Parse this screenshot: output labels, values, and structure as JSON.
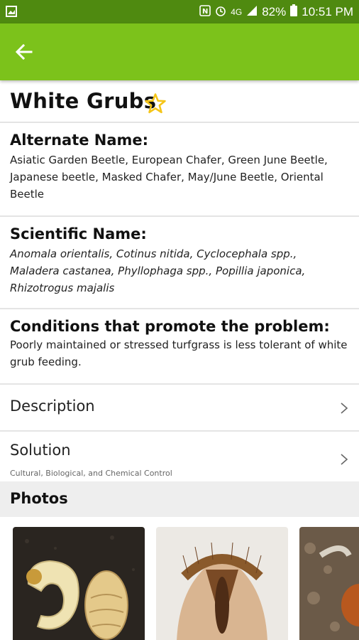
{
  "status_bar": {
    "battery": "82%",
    "network": "4G",
    "time": "10:51 PM",
    "icons": [
      "image-icon",
      "nfc-icon",
      "alarm-icon",
      "signal-icon",
      "battery-icon"
    ]
  },
  "colors": {
    "status_bar": "#4f8a10",
    "app_bar": "#7cc21b",
    "star": "#f5c518",
    "divider": "#e4e4e4",
    "photos_header_bg": "#eeeeee"
  },
  "page": {
    "title": "White Grubs"
  },
  "alternate_name": {
    "label": "Alternate Name:",
    "value": "Asiatic Garden Beetle, European Chafer, Green June Beetle, Japanese beetle, Masked Chafer, May/June Beetle, Oriental Beetle"
  },
  "scientific_name": {
    "label": "Scientific Name:",
    "value": "Anomala orientalis, Cotinus nitida, Cyclocephala spp., Maladera castanea, Phyllophaga spp., Popillia japonica, Rhizotrogus majalis"
  },
  "conditions": {
    "label": "Conditions that promote the problem:",
    "value": "Poorly maintained or stressed turfgrass is less tolerant of white grub feeding."
  },
  "description": {
    "label": "Description"
  },
  "solution": {
    "label": "Solution",
    "subtitle": "Cultural, Biological, and Chemical Control"
  },
  "photos": {
    "label": "Photos"
  }
}
